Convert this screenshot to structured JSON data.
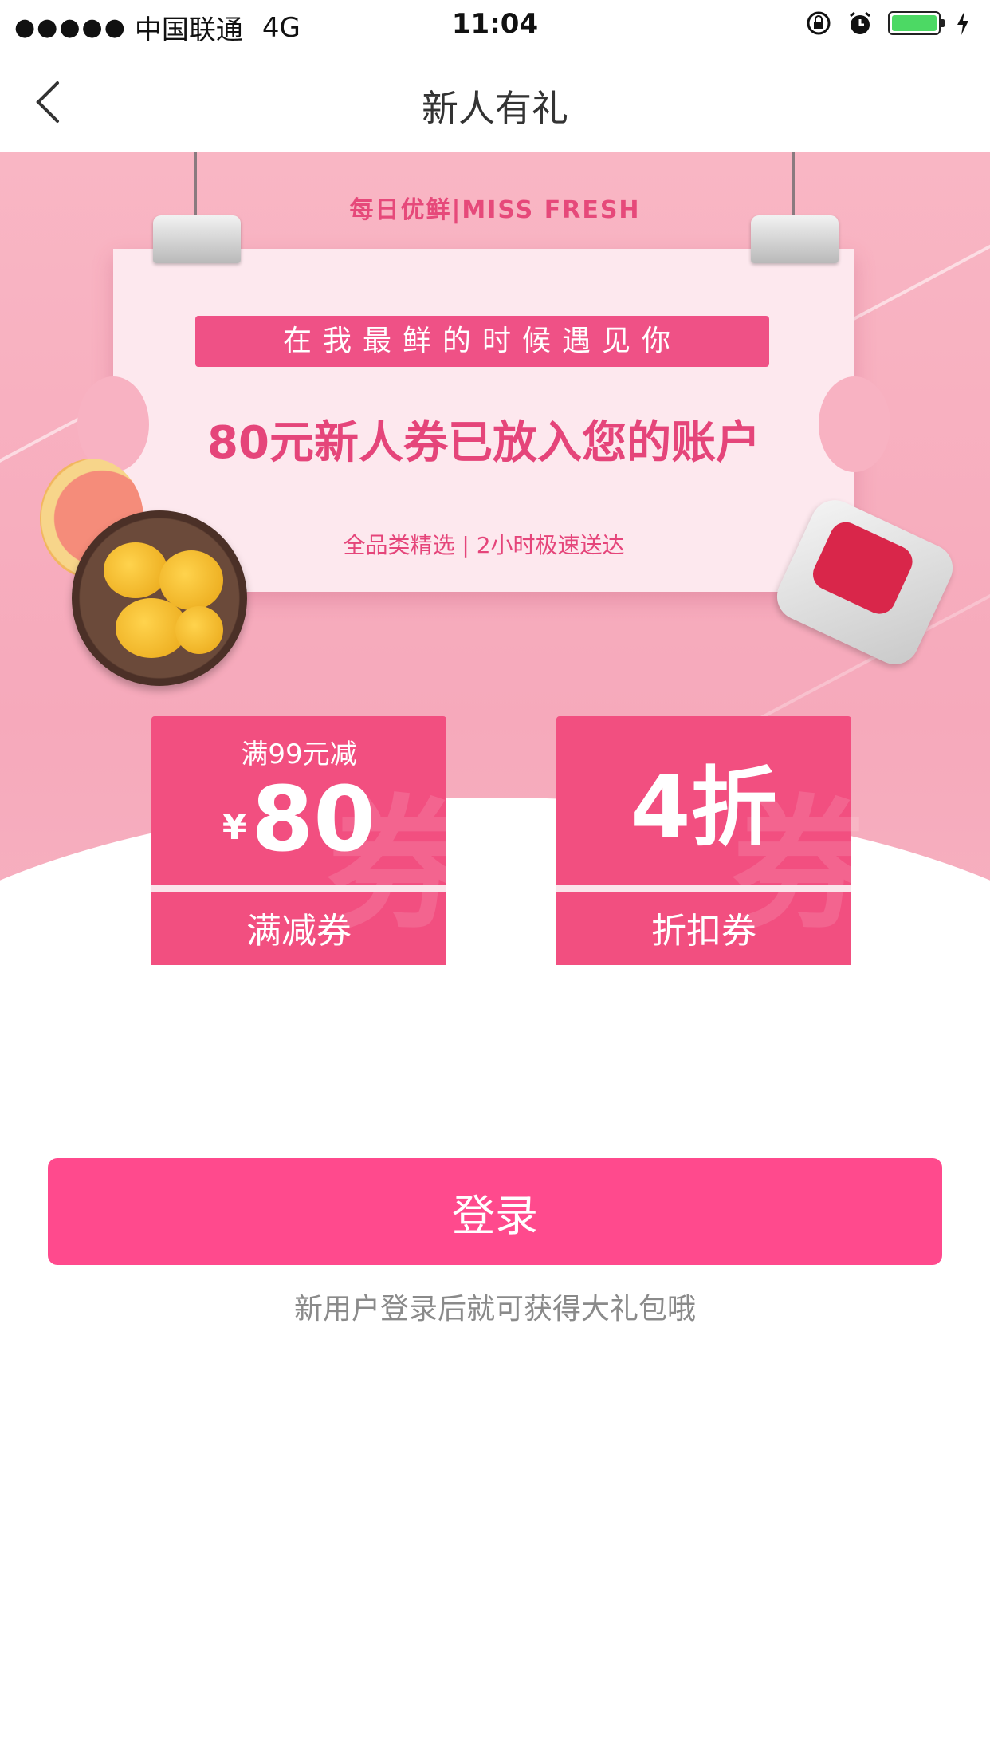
{
  "status_bar": {
    "signal_dots": "●●●●●",
    "carrier": "中国联通",
    "network": "4G",
    "time": "11:04",
    "icons": [
      "orientation-lock-icon",
      "alarm-icon",
      "battery-icon",
      "charging-icon"
    ],
    "battery_level": 1.0
  },
  "nav": {
    "back_icon": "chevron-left-icon",
    "title": "新人有礼"
  },
  "banner": {
    "brand": "每日优鲜|MISS FRESH",
    "slogan": "在我最鲜的时候遇见你",
    "headline": "80元新人券已放入您的账户",
    "tagline": "全品类精选 | 2小时极速送达"
  },
  "coupons": [
    {
      "condition": "满99元减",
      "currency": "¥",
      "amount": "80",
      "name": "满减券",
      "bg_char": "券"
    },
    {
      "value": "4折",
      "name": "折扣券",
      "bg_char": "券"
    }
  ],
  "login": {
    "button_label": "登录",
    "hint": "新用户登录后就可获得大礼包哦"
  },
  "colors": {
    "accent": "#ff4a8d",
    "coupon": "#f24f80",
    "banner_pink": "#f6a9bb"
  }
}
